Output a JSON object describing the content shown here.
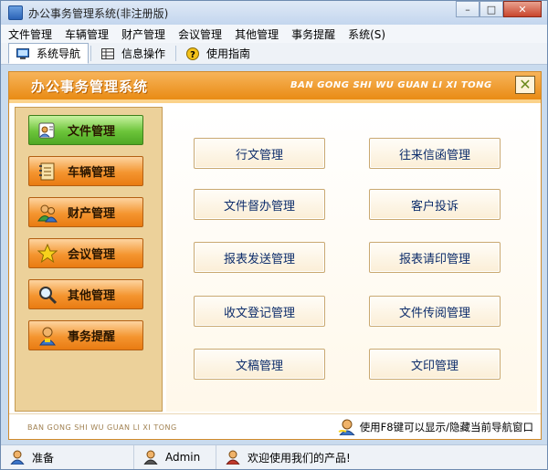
{
  "window": {
    "title": "办公事务管理系统(非注册版)"
  },
  "menu": [
    "文件管理",
    "车辆管理",
    "财产管理",
    "会议管理",
    "其他管理",
    "事务提醒",
    "系统(S)"
  ],
  "toolbar": [
    {
      "label": "系统导航",
      "icon": "monitor-icon",
      "active": true
    },
    {
      "label": "信息操作",
      "icon": "grid-icon",
      "active": false
    },
    {
      "label": "使用指南",
      "icon": "help-icon",
      "active": false
    }
  ],
  "header": {
    "title": "办公事务管理系统",
    "pinyin": "BAN GONG SHI WU  GUAN LI XI TONG",
    "close_glyph": "✕"
  },
  "nav": [
    {
      "label": "文件管理",
      "icon": "document-user-icon",
      "active": true
    },
    {
      "label": "车辆管理",
      "icon": "notebook-icon",
      "active": false
    },
    {
      "label": "财产管理",
      "icon": "people-icon",
      "active": false
    },
    {
      "label": "会议管理",
      "icon": "star-icon",
      "active": false
    },
    {
      "label": "其他管理",
      "icon": "magnifier-icon",
      "active": false
    },
    {
      "label": "事务提醒",
      "icon": "reminder-user-icon",
      "active": false
    }
  ],
  "content_buttons": [
    "行文管理",
    "往来信函管理",
    "文件督办管理",
    "客户投诉",
    "报表发送管理",
    "报表请印管理",
    "收文登记管理",
    "文件传阅管理",
    "文稿管理",
    "文印管理"
  ],
  "bottom": {
    "pinyin": "BAN GONG SHI WU GUAN LI XI TONG",
    "hint": "使用F8键可以显示/隐藏当前导航窗口"
  },
  "status": {
    "state": "准备",
    "user": "Admin",
    "message": "欢迎使用我们的产品!"
  },
  "window_buttons": {
    "minimize": "–",
    "maximize": "□",
    "close": "✕"
  }
}
